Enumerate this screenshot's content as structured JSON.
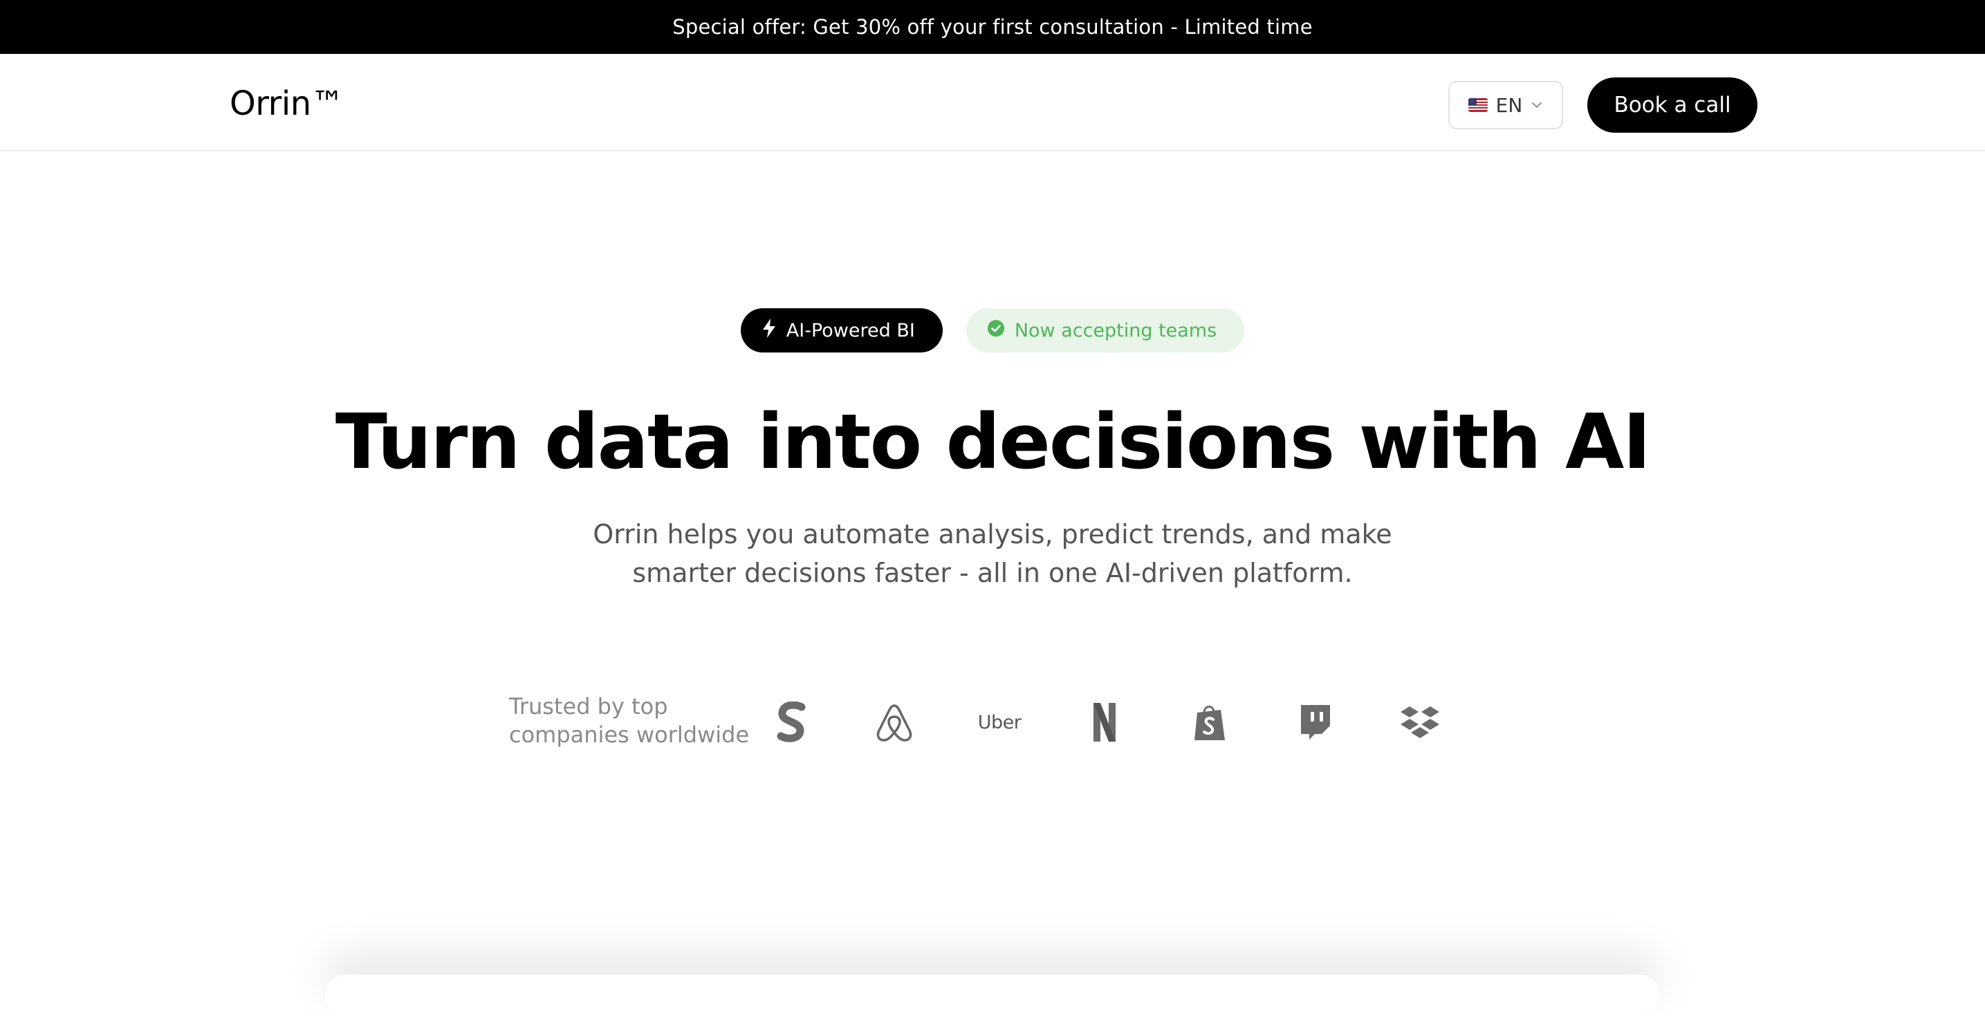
{
  "promo": {
    "text": "Special offer: Get 30% off your first consultation - Limited time"
  },
  "header": {
    "logo": "Orrin™",
    "language": {
      "code": "EN",
      "flag_icon": "us-flag-icon"
    },
    "cta_label": "Book a call"
  },
  "badges": {
    "primary": {
      "label": "AI-Powered BI",
      "icon": "lightning-icon"
    },
    "status": {
      "label": "Now accepting teams",
      "icon": "check-circle-icon",
      "color": "#4fb55a"
    }
  },
  "hero": {
    "headline": "Turn data into decisions with AI",
    "subheadline_line1": "Orrin helps you automate analysis, predict trends, and make",
    "subheadline_line2": "smarter decisions faster - all in one AI-driven platform."
  },
  "trusted": {
    "line1": "Trusted by top",
    "line2": "companies worldwide",
    "logos": [
      "stripe-icon",
      "airbnb-icon",
      "Uber",
      "netflix-icon",
      "shopify-icon",
      "twitch-icon",
      "dropbox-icon"
    ]
  },
  "colors": {
    "accent": "#000000",
    "success": "#4fb55a",
    "muted": "#8a8a8a"
  }
}
